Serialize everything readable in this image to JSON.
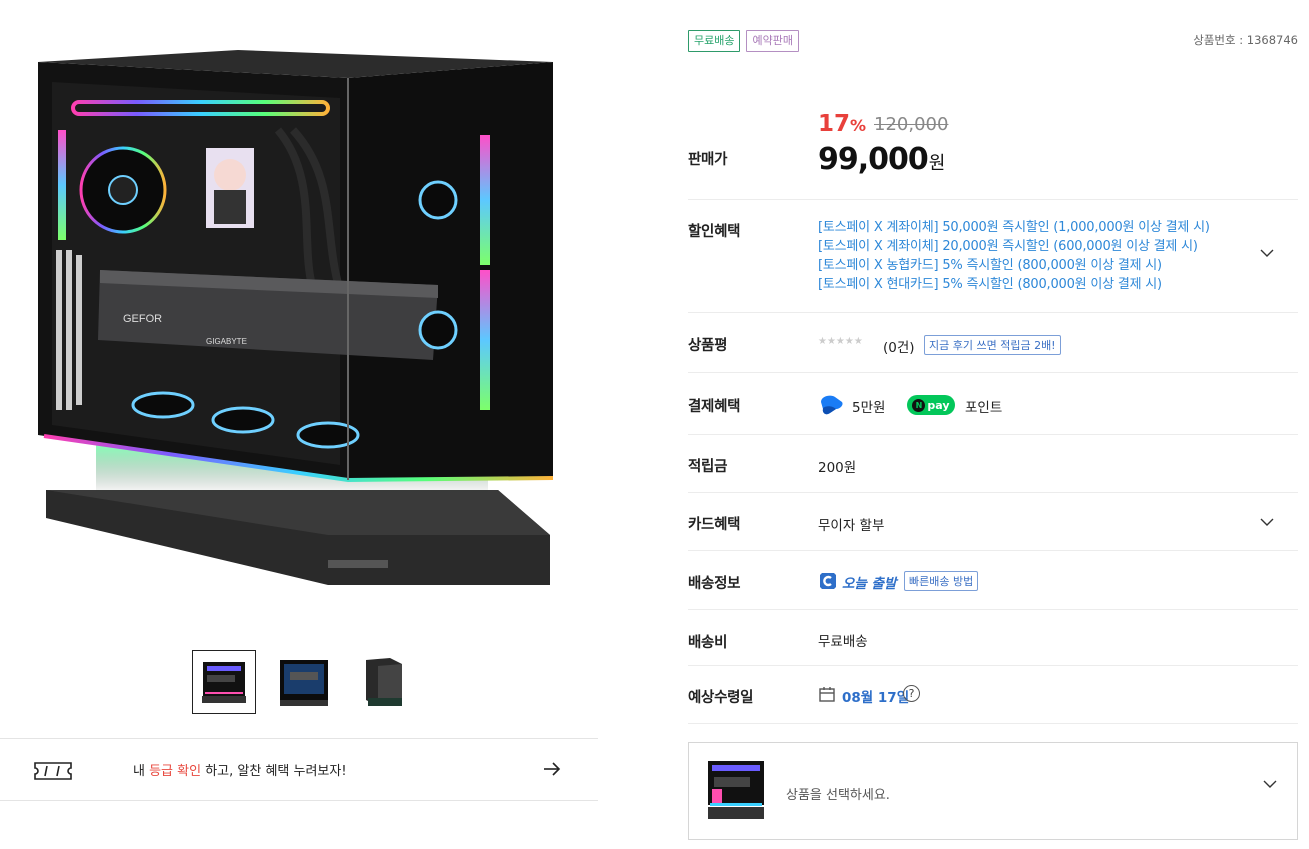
{
  "gallery": {
    "main_image": "pc-case-product-photo",
    "thumbnails": [
      {
        "name": "thumbnail-1",
        "active": true
      },
      {
        "name": "thumbnail-2",
        "active": false
      },
      {
        "name": "thumbnail-3",
        "active": false
      }
    ]
  },
  "grade_banner": {
    "prefix": "내 ",
    "highlight": "등급 확인",
    "suffix": " 하고, 알찬 혜택 누려보자!",
    "icon": "ticket-icon",
    "arrow_icon": "arrow-right-icon"
  },
  "badges": {
    "free_shipping": "무료배송",
    "preorder": "예약판매"
  },
  "product_no": "상품번호 : 1368746",
  "price": {
    "label": "판매가",
    "discount_num": "17",
    "discount_pct": "%",
    "original": "120,000",
    "sale": "99,000",
    "won": "원"
  },
  "discounts": {
    "label": "할인혜택",
    "items": [
      "[토스페이 X 계좌이체] 50,000원 즉시할인 (1,000,000원 이상 결제 시)",
      "[토스페이 X 계좌이체] 20,000원 즉시할인 (600,000원 이상 결제 시)",
      "[토스페이 X 농협카드] 5% 즉시할인 (800,000원 이상 결제 시)",
      "[토스페이 X 현대카드] 5% 즉시할인 (800,000원 이상 결제 시)"
    ]
  },
  "review": {
    "label": "상품평",
    "stars": "★★★★★",
    "rating": 0,
    "count": "(0건)",
    "tip": "지금 후기 쓰면 적립금 2배!"
  },
  "payment": {
    "label": "결제혜택",
    "toss_text": "5만원",
    "npay_text": "pay",
    "npay_n": "N",
    "point_text": "포인트"
  },
  "points": {
    "label": "적립금",
    "value": "200원"
  },
  "card": {
    "label": "카드혜택",
    "value": "무이자 할부"
  },
  "shipping": {
    "label": "배송정보",
    "today": "오늘 출발",
    "tip": "빠른배송 방법"
  },
  "shipping_fee": {
    "label": "배송비",
    "value": "무료배송"
  },
  "eta": {
    "label": "예상수령일",
    "date": "08월 17일",
    "help": "?"
  },
  "option_select": {
    "placeholder": "상품을 선택하세요."
  },
  "colors": {
    "discount": "#e8403b",
    "link_blue": "#2e88d8",
    "free_badge": "#26a36b",
    "preorder_badge": "#a879b8",
    "npay_green": "#03c75a"
  }
}
